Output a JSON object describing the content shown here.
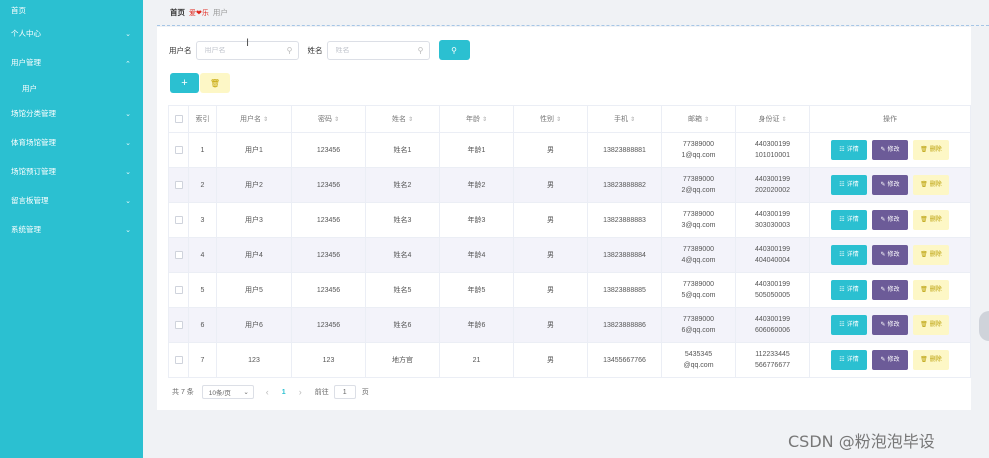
{
  "sidebar": {
    "items": [
      {
        "label": "首页"
      },
      {
        "label": "个人中心"
      },
      {
        "label": "用户管理"
      },
      {
        "label": "用户"
      },
      {
        "label": "场馆分类管理"
      },
      {
        "label": "体育场馆管理"
      },
      {
        "label": "场馆预订管理"
      },
      {
        "label": "留言板管理"
      },
      {
        "label": "系统管理"
      }
    ]
  },
  "breadcrumb": {
    "home": "首页",
    "sep": "爱❤乐",
    "current": "用户"
  },
  "search": {
    "username_label": "用户名",
    "username_placeholder": "用户名",
    "name_label": "姓名",
    "name_placeholder": "姓名"
  },
  "table": {
    "headers": {
      "index": "索引",
      "username": "用户名",
      "password": "密码",
      "name": "姓名",
      "age": "年龄",
      "gender": "性别",
      "phone": "手机",
      "email": "邮箱",
      "idcard": "身份证",
      "actions": "操作"
    },
    "action_labels": {
      "detail": "详情",
      "edit": "修改",
      "remove": "删除"
    },
    "rows": [
      {
        "index": "1",
        "username": "用户1",
        "password": "123456",
        "name": "姓名1",
        "age": "年龄1",
        "gender": "男",
        "phone": "13823888881",
        "email": "773890001@qq.com",
        "idcard": "440300199101010001"
      },
      {
        "index": "2",
        "username": "用户2",
        "password": "123456",
        "name": "姓名2",
        "age": "年龄2",
        "gender": "男",
        "phone": "13823888882",
        "email": "773890002@qq.com",
        "idcard": "440300199202020002"
      },
      {
        "index": "3",
        "username": "用户3",
        "password": "123456",
        "name": "姓名3",
        "age": "年龄3",
        "gender": "男",
        "phone": "13823888883",
        "email": "773890003@qq.com",
        "idcard": "440300199303030003"
      },
      {
        "index": "4",
        "username": "用户4",
        "password": "123456",
        "name": "姓名4",
        "age": "年龄4",
        "gender": "男",
        "phone": "13823888884",
        "email": "773890004@qq.com",
        "idcard": "440300199404040004"
      },
      {
        "index": "5",
        "username": "用户5",
        "password": "123456",
        "name": "姓名5",
        "age": "年龄5",
        "gender": "男",
        "phone": "13823888885",
        "email": "773890005@qq.com",
        "idcard": "440300199505050005"
      },
      {
        "index": "6",
        "username": "用户6",
        "password": "123456",
        "name": "姓名6",
        "age": "年龄6",
        "gender": "男",
        "phone": "13823888886",
        "email": "773890006@qq.com",
        "idcard": "440300199606060006"
      },
      {
        "index": "7",
        "username": "123",
        "password": "123",
        "name": "地方官",
        "age": "21",
        "gender": "男",
        "phone": "13455667766",
        "email": "5435345@qq.com",
        "idcard": "112233445566776677"
      }
    ]
  },
  "pager": {
    "total": "共 7 条",
    "page_size": "10条/页",
    "current_page": "1",
    "goto_label": "前往",
    "goto_value": "1",
    "page_unit": "页"
  },
  "watermark": "CSDN @粉泡泡毕设",
  "colors": {
    "accent": "#2bc0d1",
    "edit": "#6c5b98",
    "delete_bg": "#fdf7c6"
  }
}
